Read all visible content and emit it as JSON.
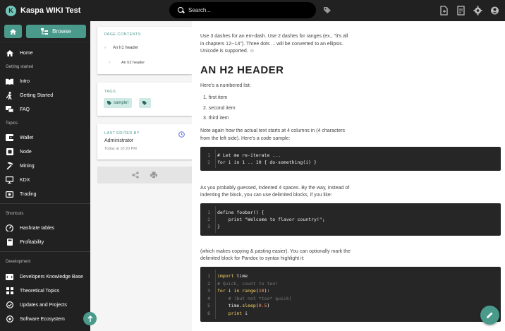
{
  "header": {
    "site_title": "Kaspa WIKI Test",
    "search_placeholder": "Search...",
    "icons": [
      "tags-icon",
      "new-page-icon",
      "pages-list-icon",
      "settings-icon",
      "account-icon"
    ]
  },
  "sidebar": {
    "browse_label": "Browse",
    "home_label": "Home",
    "sections": {
      "getting_started": "Getting started",
      "topics": "Topics",
      "shortcuts": "Shortcuts",
      "development": "Development"
    },
    "items": {
      "intro": "Intro",
      "getting_started": "Getting Started",
      "faq": "FAQ",
      "wallet": "Wallet",
      "node": "Node",
      "mining": "Mining",
      "kdx": "KDX",
      "trading": "Trading",
      "hashrate": "Hashrate tables",
      "profitability": "Profitability",
      "dev_kb": "Developers Knowledge Base",
      "theoretical": "Theoretical Topics",
      "updates": "Updates and Projects",
      "software": "Software Ecosystem"
    }
  },
  "toc": {
    "label": "PAGE CONTENTS",
    "h1": "An h1 header",
    "h2": "An h2 header"
  },
  "tags": {
    "label": "TAGS",
    "tag1": "sample!"
  },
  "edited": {
    "label": "LAST EDITED BY",
    "author": "Administrator",
    "time": "Today at 10:20 PM"
  },
  "content": {
    "p1a": "Use 3 dashes for an em-dash. Use 2 dashes for ranges (ex., \"it's all",
    "p1b": "in chapters 12--14\"). Three dots ... will be converted to an ellipsis.",
    "p1c": "Unicode is supported. ☺",
    "h2": "AN H2 HEADER",
    "numbered_intro": "Here's a numbered list:",
    "list": [
      "first item",
      "second item",
      "third item"
    ],
    "p2a": "Note again how the actual text starts at 4 columns in (4 characters",
    "p2b": "from the left side). Here's a code sample:",
    "p3a": "As you probably guessed, indented 4 spaces. By the way, instead of",
    "p3b": "indenting the block, you can use delimited blocks, if you like:",
    "p4a": "(which makes copying & pasting easier). You can optionally mark the",
    "p4b": "delimited block for Pandoc to syntax highlight it:",
    "code1": [
      "# Let me re-iterate ...",
      "for i in 1 .. 10 { do-something(i) }"
    ],
    "code2": [
      "define foobar() {",
      "    print \"Welcome to flavor country!\";",
      "}"
    ],
    "code3": {
      "l1a": "import",
      "l1b": " time",
      "l2": "# Quick, count to ten!",
      "l3a": "for",
      "l3b": " i ",
      "l3c": "in",
      "l3d": " range",
      "l3e": "(",
      "l3f": "10",
      "l3g": "):",
      "l4": "    # (but not *too* quick)",
      "l5a": "    time.",
      "l5b": "sleep",
      "l5c": "(",
      "l5d": "0.5",
      "l5e": ")",
      "l6a": "    print",
      "l6b": " i"
    }
  },
  "colors": {
    "accent": "#4a9a8c",
    "topbar": "#212121",
    "code_bg": "#262626"
  }
}
